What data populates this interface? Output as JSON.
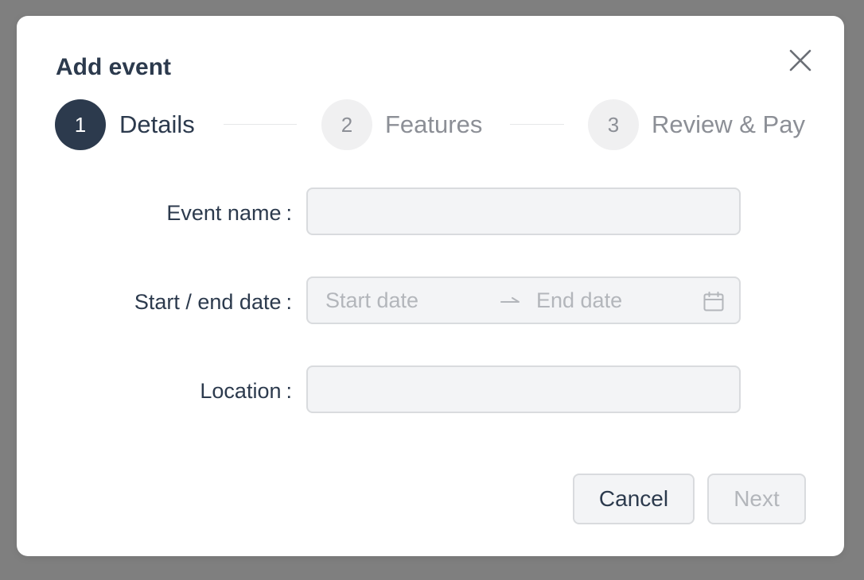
{
  "dialog": {
    "title": "Add event",
    "close_icon": "close-icon"
  },
  "stepper": {
    "steps": [
      {
        "number": "1",
        "label": "Details",
        "state": "active"
      },
      {
        "number": "2",
        "label": "Features",
        "state": "inactive"
      },
      {
        "number": "3",
        "label": "Review & Pay",
        "state": "inactive"
      }
    ]
  },
  "form": {
    "event_name": {
      "label": "Event name",
      "value": "",
      "placeholder": ""
    },
    "dates": {
      "label": "Start / end date",
      "start_placeholder": "Start date",
      "end_placeholder": "End date",
      "separator_icon": "arrow-right-icon",
      "calendar_icon": "calendar-icon"
    },
    "location": {
      "label": "Location",
      "value": "",
      "placeholder": ""
    }
  },
  "footer": {
    "cancel_label": "Cancel",
    "next_label": "Next"
  },
  "colors": {
    "overlay": "#7f7f7f",
    "primary": "#2c3a4d",
    "muted": "#8c8f96",
    "field_bg": "#f3f4f6",
    "border": "#d9dbde",
    "placeholder": "#b3b6bb"
  }
}
